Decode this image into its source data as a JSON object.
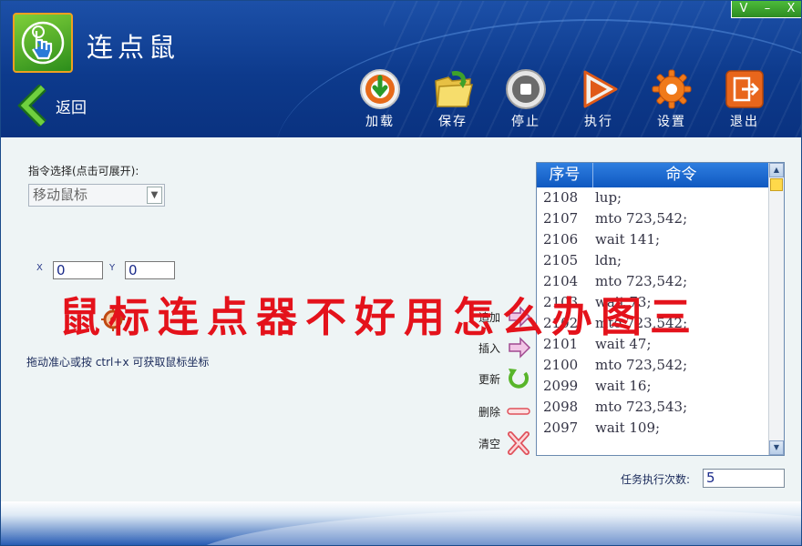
{
  "app": {
    "title": "连点鼠"
  },
  "window_controls": [
    "V",
    "–",
    "X"
  ],
  "nav": {
    "back_label": "返回"
  },
  "toolbar": [
    {
      "label": "加载",
      "icon": "load-icon"
    },
    {
      "label": "保存",
      "icon": "save-folder-icon"
    },
    {
      "label": "停止",
      "icon": "stop-icon"
    },
    {
      "label": "执行",
      "icon": "play-icon"
    },
    {
      "label": "设置",
      "icon": "gear-icon"
    },
    {
      "label": "退出",
      "icon": "exit-icon"
    }
  ],
  "command": {
    "select_label": "指令选择(点击可展开):",
    "selected": "移动鼠标"
  },
  "coords": {
    "x_label": "X",
    "x_value": "0",
    "y_label": "Y",
    "y_value": "0"
  },
  "hint": "拖动准心或按 ctrl+x 可获取鼠标坐标",
  "actions": [
    {
      "label": "追加",
      "icon": "append-arrow-icon"
    },
    {
      "label": "插入",
      "icon": "insert-arrow-icon"
    },
    {
      "label": "更新",
      "icon": "refresh-icon"
    },
    {
      "label": "删除",
      "icon": "minus-icon"
    },
    {
      "label": "清空",
      "icon": "clear-x-icon"
    }
  ],
  "list": {
    "col_seq": "序号",
    "col_cmd": "命令",
    "rows": [
      {
        "seq": "2108",
        "cmd": "lup;"
      },
      {
        "seq": "2107",
        "cmd": "mto 723,542;"
      },
      {
        "seq": "2106",
        "cmd": "wait 141;"
      },
      {
        "seq": "2105",
        "cmd": "ldn;"
      },
      {
        "seq": "2104",
        "cmd": "mto 723,542;"
      },
      {
        "seq": "2103",
        "cmd": "wait 73;"
      },
      {
        "seq": "2102",
        "cmd": "mto 723,542;"
      },
      {
        "seq": "2101",
        "cmd": "wait 47;"
      },
      {
        "seq": "2100",
        "cmd": "mto 723,542;"
      },
      {
        "seq": "2099",
        "cmd": "wait 16;"
      },
      {
        "seq": "2098",
        "cmd": "mto 723,543;"
      },
      {
        "seq": "2097",
        "cmd": "wait 109;"
      }
    ]
  },
  "task": {
    "count_label": "任务执行次数:",
    "count_value": "5"
  },
  "overlay_text": "鼠标连点器不好用怎么办图三",
  "colors": {
    "header_blue": "#0d3a8c",
    "overlay_red": "#e4121b",
    "accent_green": "#3aa52a"
  }
}
